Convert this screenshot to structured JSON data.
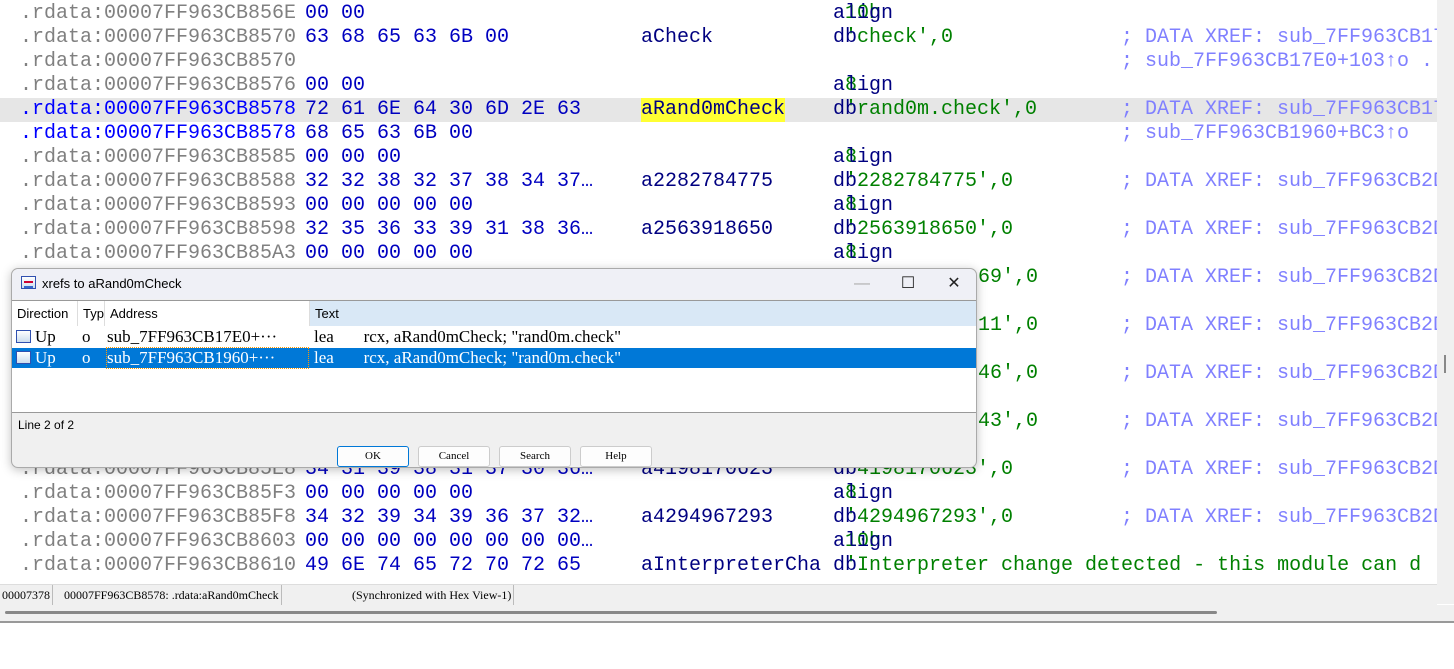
{
  "listing": {
    "rows": [
      {
        "addr": ".rdata:00007FF963CB856E",
        "bytes": "00 00",
        "name": "",
        "op": "align",
        "str": "10h",
        "tail": "",
        "comment": ""
      },
      {
        "addr": ".rdata:00007FF963CB8570",
        "bytes": "63 68 65 63 6B 00",
        "name": "aCheck",
        "op": "db",
        "str": "'check'",
        "tail": ",0",
        "comment": "; DATA XREF: sub_7FF963CB17"
      },
      {
        "addr": ".rdata:00007FF963CB8570",
        "bytes": "",
        "name": "",
        "op": "",
        "str": "",
        "tail": "",
        "comment": "; sub_7FF963CB17E0+103↑o ."
      },
      {
        "addr": ".rdata:00007FF963CB8576",
        "bytes": "00 00",
        "name": "",
        "op": "align",
        "str": "8",
        "tail": "",
        "comment": ""
      },
      {
        "addr": ".rdata:00007FF963CB8578",
        "bytes": "72 61 6E 64 30 6D 2E 63",
        "name": "aRand0mCheck",
        "op": "db",
        "str": "'rand0m.check'",
        "tail": ",0",
        "comment": "; DATA XREF: sub_7FF963CB17",
        "highlight": true,
        "current": true,
        "selected_name": true
      },
      {
        "addr": ".rdata:00007FF963CB8578",
        "bytes": "68 65 63 6B 00",
        "name": "",
        "op": "",
        "str": "",
        "tail": "",
        "comment": "; sub_7FF963CB1960+BC3↑o",
        "current": true
      },
      {
        "addr": ".rdata:00007FF963CB8585",
        "bytes": "00 00 00",
        "name": "",
        "op": "align",
        "str": "8",
        "tail": "",
        "comment": ""
      },
      {
        "addr": ".rdata:00007FF963CB8588",
        "bytes": "32 32 38 32 37 38 34 37…",
        "name": "a2282784775",
        "op": "db",
        "str": "'2282784775'",
        "tail": ",0",
        "comment": "; DATA XREF: sub_7FF963CB2D"
      },
      {
        "addr": ".rdata:00007FF963CB8593",
        "bytes": "00 00 00 00 00",
        "name": "",
        "op": "align",
        "str": "8",
        "tail": "",
        "comment": ""
      },
      {
        "addr": ".rdata:00007FF963CB8598",
        "bytes": "32 35 36 33 39 31 38 36…",
        "name": "a2563918650",
        "op": "db",
        "str": "'2563918650'",
        "tail": ",0",
        "comment": "; DATA XREF: sub_7FF963CB2D"
      },
      {
        "addr": ".rdata:00007FF963CB85A3",
        "bytes": "00 00 00 00 00",
        "name": "",
        "op": "align",
        "str": "8",
        "tail": "",
        "comment": ""
      },
      {
        "partial": "69',0",
        "comment": "; DATA XREF: sub_7FF963CB2D"
      },
      {},
      {
        "partial": "11',0",
        "comment": "; DATA XREF: sub_7FF963CB2D"
      },
      {},
      {
        "partial": "46',0",
        "comment": "; DATA XREF: sub_7FF963CB2D"
      },
      {},
      {
        "partial": "43',0",
        "comment": "; DATA XREF: sub_7FF963CB2D"
      },
      {},
      {
        "addr": ".rdata:00007FF963CB85E8",
        "bytes": "34 31 39 38 31 37 30 36…",
        "name": "a4198170623",
        "op": "db",
        "str": "'4198170623'",
        "tail": ",0",
        "comment": "; DATA XREF: sub_7FF963CB2D"
      },
      {
        "addr": ".rdata:00007FF963CB85F3",
        "bytes": "00 00 00 00 00",
        "name": "",
        "op": "align",
        "str": "8",
        "tail": "",
        "comment": ""
      },
      {
        "addr": ".rdata:00007FF963CB85F8",
        "bytes": "34 32 39 34 39 36 37 32…",
        "name": "a4294967293",
        "op": "db",
        "str": "'4294967293'",
        "tail": ",0",
        "comment": "; DATA XREF: sub_7FF963CB2D"
      },
      {
        "addr": ".rdata:00007FF963CB8603",
        "bytes": "00 00 00 00 00 00 00 00…",
        "name": "",
        "op": "align",
        "str": "10h",
        "tail": "",
        "comment": ""
      },
      {
        "addr": ".rdata:00007FF963CB8610",
        "bytes": "49 6E 74 65 72 70 72 65",
        "name": "aInterpreterCha",
        "op": "db",
        "str": "'Interpreter change detected - this module can d",
        "tail": "",
        "comment": ""
      }
    ]
  },
  "status": {
    "offset": "00007378",
    "location": "00007FF963CB8578: .rdata:aRand0mCheck",
    "sync": "(Synchronized with Hex View-1)"
  },
  "dialog": {
    "title": "xrefs to aRand0mCheck",
    "minimize": "—",
    "maximize": "☐",
    "close": "✕",
    "columns": [
      "Direction",
      "Typ",
      "Address",
      "Text"
    ],
    "rows": [
      {
        "direction": "Up",
        "type": "o",
        "address": "sub_7FF963CB17E0+···",
        "text": "lea       rcx, aRand0mCheck; \"rand0m.check\""
      },
      {
        "direction": "Up",
        "type": "o",
        "address": "sub_7FF963CB1960+···",
        "text": "lea       rcx, aRand0mCheck; \"rand0m.check\"",
        "selected": true
      }
    ],
    "line_count": "Line 2 of 2",
    "buttons": {
      "ok": "OK",
      "cancel": "Cancel",
      "search": "Search",
      "help": "Help"
    }
  },
  "colors": {
    "address": "#808080",
    "bytes": "#0000c0",
    "name": "#000080",
    "string": "#008000",
    "comment": "#8080ff",
    "selection": "#0078d7",
    "name_highlight": "#ffff33"
  }
}
